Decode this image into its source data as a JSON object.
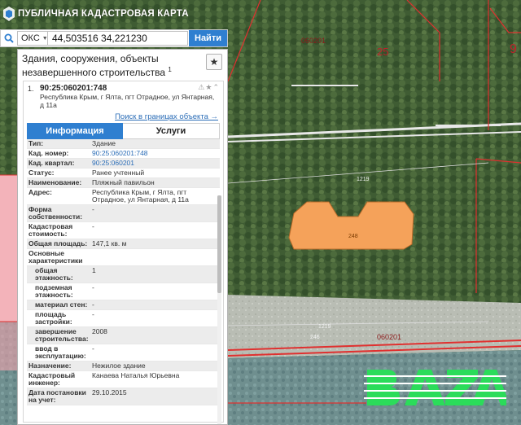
{
  "app": {
    "title": "ПУБЛИЧНАЯ КАДАСТРОВАЯ КАРТА"
  },
  "search": {
    "type_label": "ОКС",
    "query": "44,503516 34,221230",
    "button_label": "Найти"
  },
  "panel": {
    "title": "Здания, сооружения, объекты незавершенного строительства",
    "count": "1",
    "object": {
      "index": "1.",
      "cadastral_number": "90:25:060201:748",
      "address": "Республика Крым, г Ялта, пгт Отрадное, ул Янтарная, д 11а",
      "search_link": "Поиск в границах объекта →"
    },
    "tabs": [
      {
        "label": "Информация",
        "active": true
      },
      {
        "label": "Услуги",
        "active": false
      }
    ],
    "attributes": [
      {
        "key": "Тип:",
        "value": "Здание",
        "link": false,
        "sub": false
      },
      {
        "key": "Кад. номер:",
        "value": "90:25:060201:748",
        "link": true,
        "sub": false
      },
      {
        "key": "Кад. квартал:",
        "value": "90:25:060201",
        "link": true,
        "sub": false
      },
      {
        "key": "Статус:",
        "value": "Ранее учтенный",
        "link": false,
        "sub": false
      },
      {
        "key": "Наименование:",
        "value": "Пляжный павильон",
        "link": false,
        "sub": false
      },
      {
        "key": "Адрес:",
        "value": "Республика Крым, г Ялта, пгт Отрадное, ул Янтарная, д 11а",
        "link": false,
        "sub": false
      },
      {
        "key": "Форма собственности:",
        "value": "-",
        "link": false,
        "sub": false
      },
      {
        "key": "Кадастровая стоимость:",
        "value": "-",
        "link": false,
        "sub": false
      },
      {
        "key": "Общая площадь:",
        "value": "147,1 кв. м",
        "link": false,
        "sub": false
      },
      {
        "key": "Основные характеристики",
        "value": "",
        "link": false,
        "sub": false
      },
      {
        "key": "общая этажность:",
        "value": "1",
        "link": false,
        "sub": true
      },
      {
        "key": "подземная этажность:",
        "value": "-",
        "link": false,
        "sub": true
      },
      {
        "key": "материал стен:",
        "value": "-",
        "link": false,
        "sub": true
      },
      {
        "key": "площадь застройки:",
        "value": "-",
        "link": false,
        "sub": true
      },
      {
        "key": "завершение строительства:",
        "value": "2008",
        "link": false,
        "sub": true
      },
      {
        "key": "ввод в эксплуатацию:",
        "value": "-",
        "link": false,
        "sub": true
      },
      {
        "key": "Назначение:",
        "value": "Нежилое здание",
        "link": false,
        "sub": false
      },
      {
        "key": "Кадастровый инженер:",
        "value": "Канаева Наталья Юрьевна",
        "link": false,
        "sub": false
      },
      {
        "key": "Дата постановки на учет:",
        "value": "29.10.2015",
        "link": false,
        "sub": false
      }
    ]
  },
  "map": {
    "labels": {
      "quarter_top": "060201",
      "parcel_25": "25",
      "parcel_9": "9",
      "parcel_1219_top": "1219",
      "building": "248",
      "parcel_1219_bottom": "1219",
      "parcel_246": "246",
      "quarter_bottom": "060201"
    },
    "colors": {
      "building_fill": "#f5a25a",
      "boundary_red": "#e0302f",
      "quarter_pink": "#f2a0a8",
      "button_blue": "#2f7fd0"
    }
  },
  "watermark": {
    "text": "BAZA",
    "color": "#2bdc5a"
  }
}
